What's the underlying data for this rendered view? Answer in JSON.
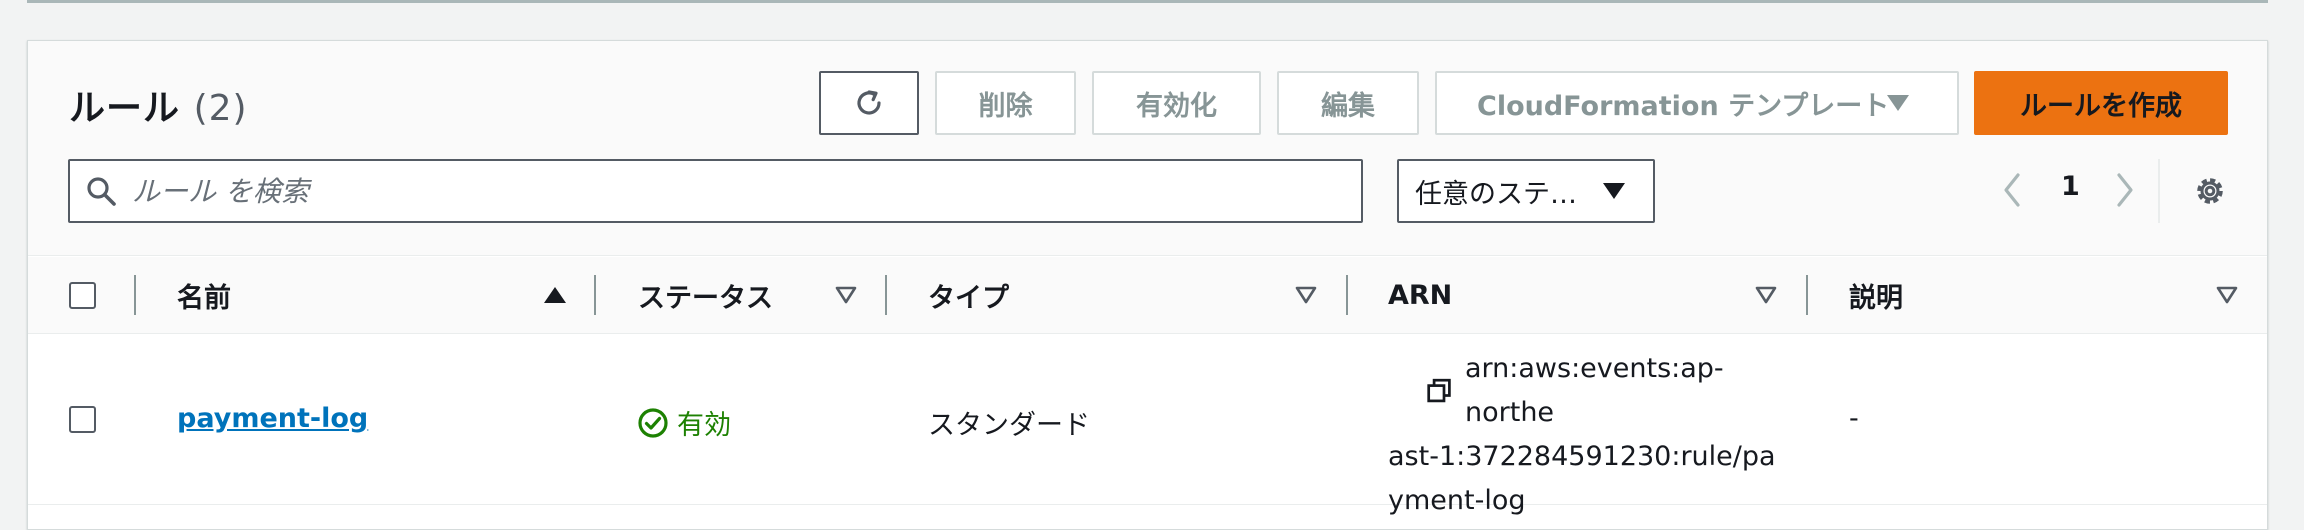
{
  "header": {
    "title": "ルール",
    "count": "(2)"
  },
  "actions": {
    "delete_label": "削除",
    "enable_label": "有効化",
    "edit_label": "編集",
    "cfn_template_label": "CloudFormation テンプレート",
    "create_label": "ルールを作成"
  },
  "filter": {
    "search_placeholder": "ルール を検索",
    "status_select_value": "任意のステ…"
  },
  "pagination": {
    "current_page": "1"
  },
  "table": {
    "columns": [
      "名前",
      "ステータス",
      "タイプ",
      "ARN",
      "説明"
    ],
    "rows": [
      {
        "name": "payment-log",
        "status": "有効",
        "type": "スタンダード",
        "arn_lines": [
          "arn:aws:events:ap-northe",
          "ast-1:372284591230:rule/pa",
          "yment-log"
        ],
        "description": "-"
      }
    ]
  },
  "colors": {
    "primary_button": "#ec7211",
    "link": "#0073bb",
    "status_ok": "#1d8102"
  },
  "icons": [
    "refresh-icon",
    "caret-down-icon",
    "search-icon",
    "chevron-left-icon",
    "chevron-right-icon",
    "gear-icon",
    "sort-asc-icon",
    "sort-desc-icon",
    "copy-icon",
    "status-ok-icon"
  ]
}
